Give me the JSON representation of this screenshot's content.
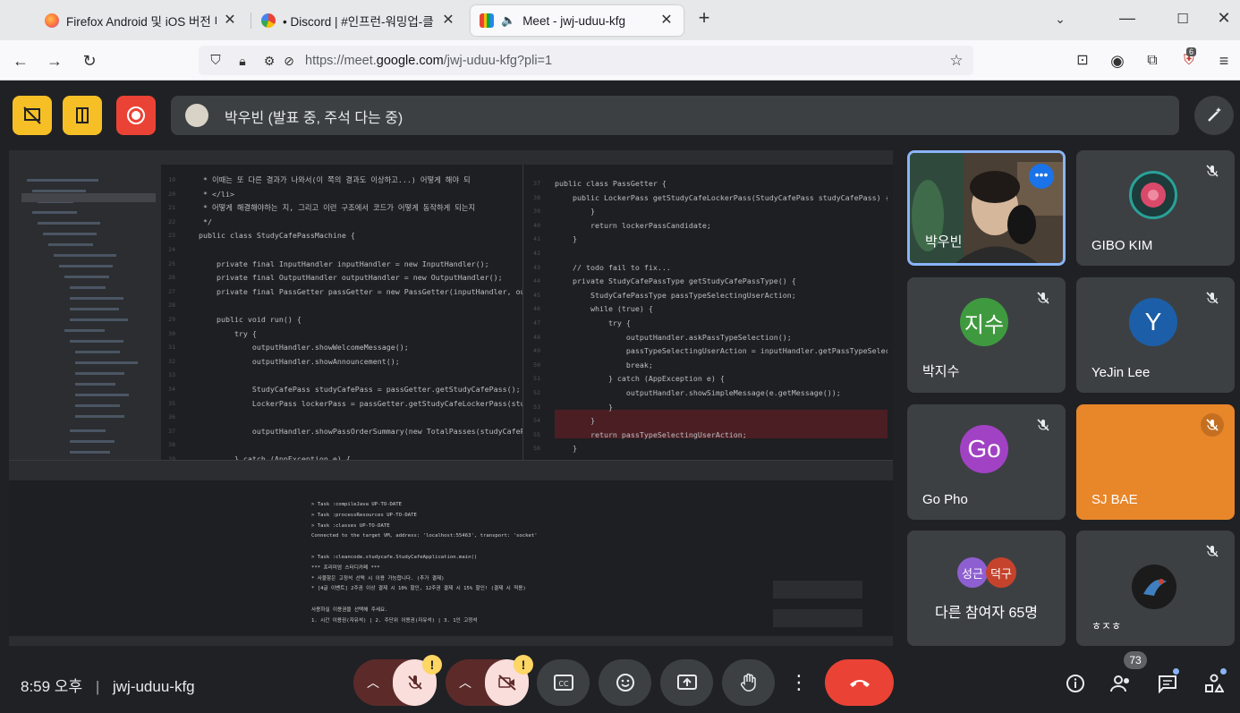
{
  "browser": {
    "tabs": [
      {
        "title": "Firefox Android 및 iOS 버전 다",
        "favicon_color": "#ff7139"
      },
      {
        "title": "• Discord | #인프런-워밍업-클",
        "favicon_color": "#5865f2"
      },
      {
        "title": "Meet - jwj-uduu-kfg",
        "favicon_color": "#00ac47"
      }
    ],
    "url_prefix": "https://meet.",
    "url_domain": "google.com",
    "url_path": "/jwj-uduu-kfg?pli=1",
    "extension_badge": "6"
  },
  "meet": {
    "presenter_label": "박우빈 (발표 중, 주석 다는 중)",
    "time": "8:59 오후",
    "meeting_code": "jwj-uduu-kfg",
    "participant_count": "73",
    "others_label": "다른 참여자 65명",
    "others_avatars": [
      {
        "text": "성근",
        "color": "#8e5fd1"
      },
      {
        "text": "덕구",
        "color": "#c5432c"
      }
    ],
    "participants": [
      {
        "name": "박우빈",
        "type": "video",
        "speaking": true
      },
      {
        "name": "GIBO KIM",
        "type": "image",
        "muted": true
      },
      {
        "name": "박지수",
        "initial": "지수",
        "avatar_color": "#3f9a3f",
        "muted": true
      },
      {
        "name": "YeJin Lee",
        "initial": "Y",
        "avatar_color": "#1c5fa8",
        "muted": true
      },
      {
        "name": "Go Pho",
        "initial": "Go",
        "avatar_color": "#a142c4",
        "muted": true
      },
      {
        "name": "SJ BAE",
        "type": "highlight",
        "color": "#e8862a",
        "muted": true
      },
      {
        "name": "ㅎㅈㅎ",
        "type": "image",
        "muted": true
      }
    ],
    "controls": {
      "warning": "!",
      "end_call_color": "#ea4335"
    }
  },
  "code_left": [
    "     * 이때는 또 다른 결과가 나와서(이 쪽의 결과도 이상하고...) 어떻게 해야 되",
    "     * </li>",
    "     * 어떻게 해결해야하는 지, 그리고 이런 구조에서 코드가 어떻게 동작하게 되는지",
    "     */",
    "    public class StudyCafePassMachine {",
    "",
    "        private final InputHandler inputHandler = new InputHandler();",
    "        private final OutputHandler outputHandler = new OutputHandler();",
    "        private final PassGetter passGetter = new PassGetter(inputHandler, outpu",
    "",
    "        public void run() {",
    "            try {",
    "                outputHandler.showWelcomeMessage();",
    "                outputHandler.showAnnouncement();",
    "",
    "                StudyCafePass studyCafePass = passGetter.getStudyCafePass();",
    "                LockerPass lockerPass = passGetter.getStudyCafeLockerPass(studyCa",
    "",
    "                outputHandler.showPassOrderSummary(new TotalPasses(studyCafePass,",
    "",
    "            } catch (AppException e) {"
  ],
  "code_right": [
    "public class PassGetter {",
    "    public LockerPass getStudyCafeLockerPass(StudyCafePass studyCafePass) {",
    "        }",
    "        return lockerPassCandidate;",
    "    }",
    "",
    "    // todo fail to fix...",
    "    private StudyCafePassType getStudyCafePassType() {",
    "        StudyCafePassType passTypeSelectingUserAction;",
    "        while (true) {",
    "            try {",
    "                outputHandler.askPassTypeSelection();",
    "                passTypeSelectingUserAction = inputHandler.getPassTypeSelect",
    "                break;",
    "            } catch (AppException e) {",
    "                outputHandler.showSimpleMessage(e.getMessage());",
    "            }",
    "        }",
    "        return passTypeSelectingUserAction;",
    "    }"
  ],
  "console": [
    "> Task :compileJava UP-TO-DATE",
    "> Task :processResources UP-TO-DATE",
    "> Task :classes UP-TO-DATE",
    "Connected to the target VM, address: 'localhost:55463', transport: 'socket'",
    "",
    "> Task :cleancode.studycafe.StudyCafeApplication.main()",
    "*** 프리미엄 스터디카페 ***",
    "* 사물함은 고정석 선택 시 이용 가능합니다. (추가 결제)",
    "* [4글 이벤트] 2주권 이상 결제 시 10% 할인, 12주권 결제 시 15% 할인! (결제 시 적용)",
    "",
    "사용하실 이용권을 선택해 주세요.",
    "1. 시간 이용권(자유석) | 2. 주단위 이용권(자유석) | 3. 1인 고정석"
  ]
}
